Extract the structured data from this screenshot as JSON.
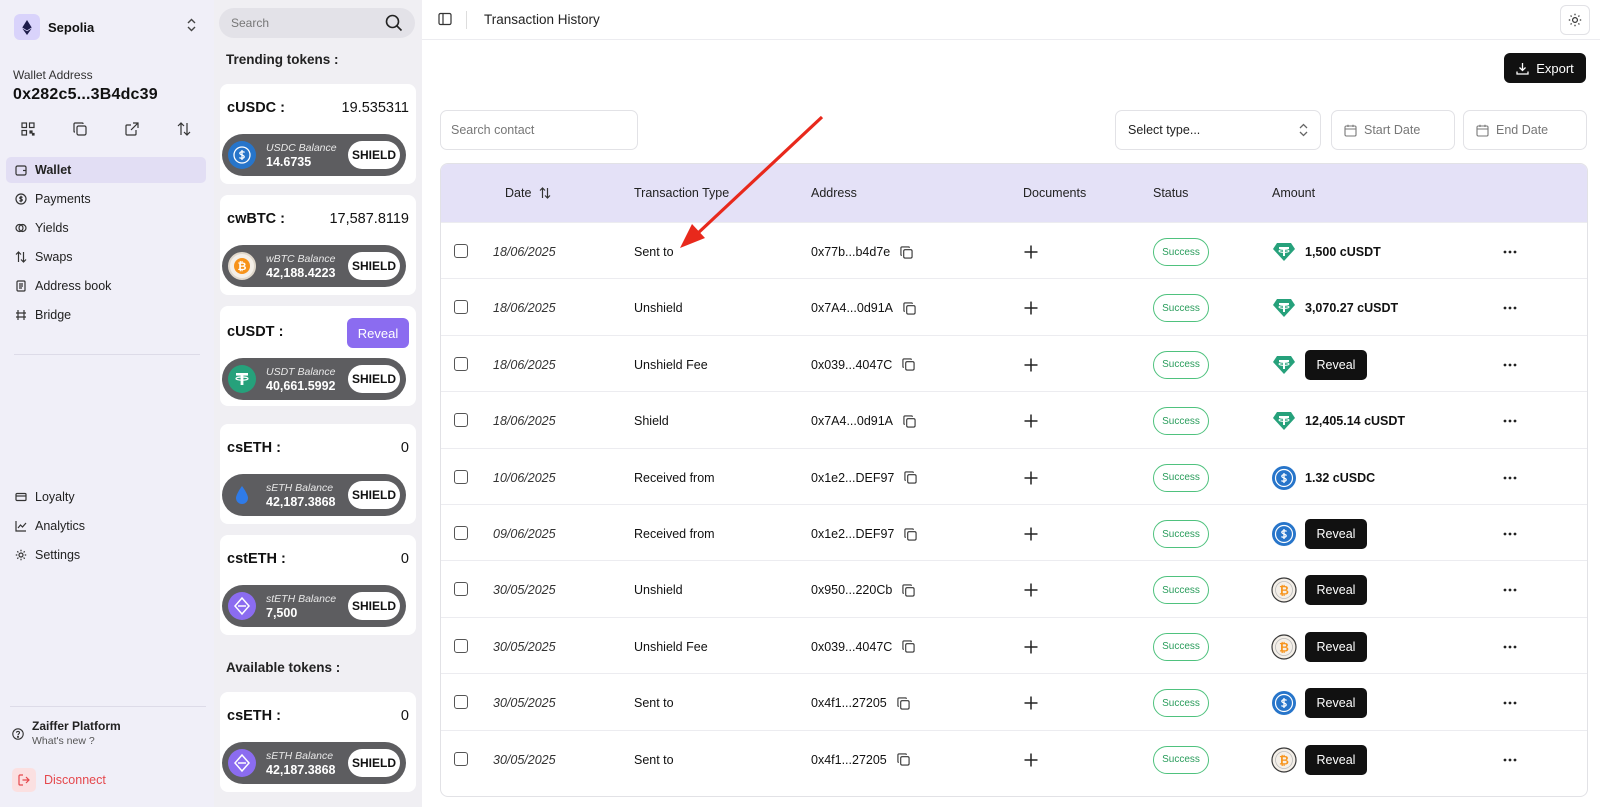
{
  "sidebar": {
    "network": "Sepolia",
    "wallet_label": "Wallet Address",
    "wallet_address": "0x282c5...3B4dc39",
    "nav": [
      {
        "label": "Wallet",
        "icon": "wallet-icon"
      },
      {
        "label": "Payments",
        "icon": "payments-icon"
      },
      {
        "label": "Yields",
        "icon": "yields-icon"
      },
      {
        "label": "Swaps",
        "icon": "swaps-icon"
      },
      {
        "label": "Address book",
        "icon": "address-book-icon"
      },
      {
        "label": "Bridge",
        "icon": "bridge-icon"
      },
      {
        "label": "Loyalty",
        "icon": "loyalty-icon"
      },
      {
        "label": "Analytics",
        "icon": "analytics-icon"
      },
      {
        "label": "Settings",
        "icon": "settings-icon"
      }
    ],
    "platform_title": "Zaiffer Platform",
    "platform_sub": "What's new ?",
    "disconnect": "Disconnect"
  },
  "tokens": {
    "search_placeholder": "Search",
    "trending_title": "Trending tokens :",
    "available_title": "Available tokens :",
    "shield_label": "SHIELD",
    "reveal_label": "Reveal",
    "trending": [
      {
        "name": "cUSDC :",
        "value": "19.535311",
        "balance_label": "USDC Balance",
        "balance": "14.6735",
        "coin": "usdc"
      },
      {
        "name": "cwBTC :",
        "value": "17,587.8119",
        "balance_label": "wBTC Balance",
        "balance": "42,188.4223",
        "coin": "btc"
      },
      {
        "name": "cUSDT :",
        "value": "",
        "balance_label": "USDT Balance",
        "balance": "40,661.5992",
        "coin": "usdt"
      },
      {
        "name": "csETH :",
        "value": "0",
        "balance_label": "sETH Balance",
        "balance": "42,187.3868",
        "coin": "seth"
      },
      {
        "name": "cstETH :",
        "value": "0",
        "balance_label": "stETH Balance",
        "balance": "7,500",
        "coin": "steth"
      }
    ],
    "available": [
      {
        "name": "csETH :",
        "value": "0",
        "balance_label": "sETH Balance",
        "balance": "42,187.3868",
        "coin": "steth"
      }
    ]
  },
  "main": {
    "title": "Transaction History",
    "export_label": "Export",
    "search_contact_placeholder": "Search contact",
    "select_type_label": "Select type...",
    "start_date_label": "Start Date",
    "end_date_label": "End Date",
    "columns": {
      "date": "Date",
      "type": "Transaction Type",
      "address": "Address",
      "documents": "Documents",
      "status": "Status",
      "amount": "Amount"
    },
    "reveal_label": "Reveal",
    "rows": [
      {
        "date": "18/06/2025",
        "type": "Sent to",
        "address": "0x77b...b4d7e",
        "status": "Success",
        "token": "usdt",
        "amount": "1,500 cUSDT"
      },
      {
        "date": "18/06/2025",
        "type": "Unshield",
        "address": "0x7A4...0d91A",
        "status": "Success",
        "token": "usdt",
        "amount": "3,070.27 cUSDT"
      },
      {
        "date": "18/06/2025",
        "type": "Unshield Fee",
        "address": "0x039...4047C",
        "status": "Success",
        "token": "usdt",
        "amount": ""
      },
      {
        "date": "18/06/2025",
        "type": "Shield",
        "address": "0x7A4...0d91A",
        "status": "Success",
        "token": "usdt",
        "amount": "12,405.14 cUSDT"
      },
      {
        "date": "10/06/2025",
        "type": "Received from",
        "address": "0x1e2...DEF97",
        "status": "Success",
        "token": "usdc",
        "amount": "1.32 cUSDC"
      },
      {
        "date": "09/06/2025",
        "type": "Received from",
        "address": "0x1e2...DEF97",
        "status": "Success",
        "token": "usdc",
        "amount": ""
      },
      {
        "date": "30/05/2025",
        "type": "Unshield",
        "address": "0x950...220Cb",
        "status": "Success",
        "token": "btc",
        "amount": ""
      },
      {
        "date": "30/05/2025",
        "type": "Unshield Fee",
        "address": "0x039...4047C",
        "status": "Success",
        "token": "btc",
        "amount": ""
      },
      {
        "date": "30/05/2025",
        "type": "Sent to",
        "address": "0x4f1...27205",
        "status": "Success",
        "token": "usdc",
        "amount": ""
      },
      {
        "date": "30/05/2025",
        "type": "Sent to",
        "address": "0x4f1...27205",
        "status": "Success",
        "token": "btc",
        "amount": ""
      }
    ]
  },
  "colors": {
    "accent": "#8b6cf0",
    "success": "#2a9d5c",
    "annotation_arrow": "#e8291c"
  }
}
